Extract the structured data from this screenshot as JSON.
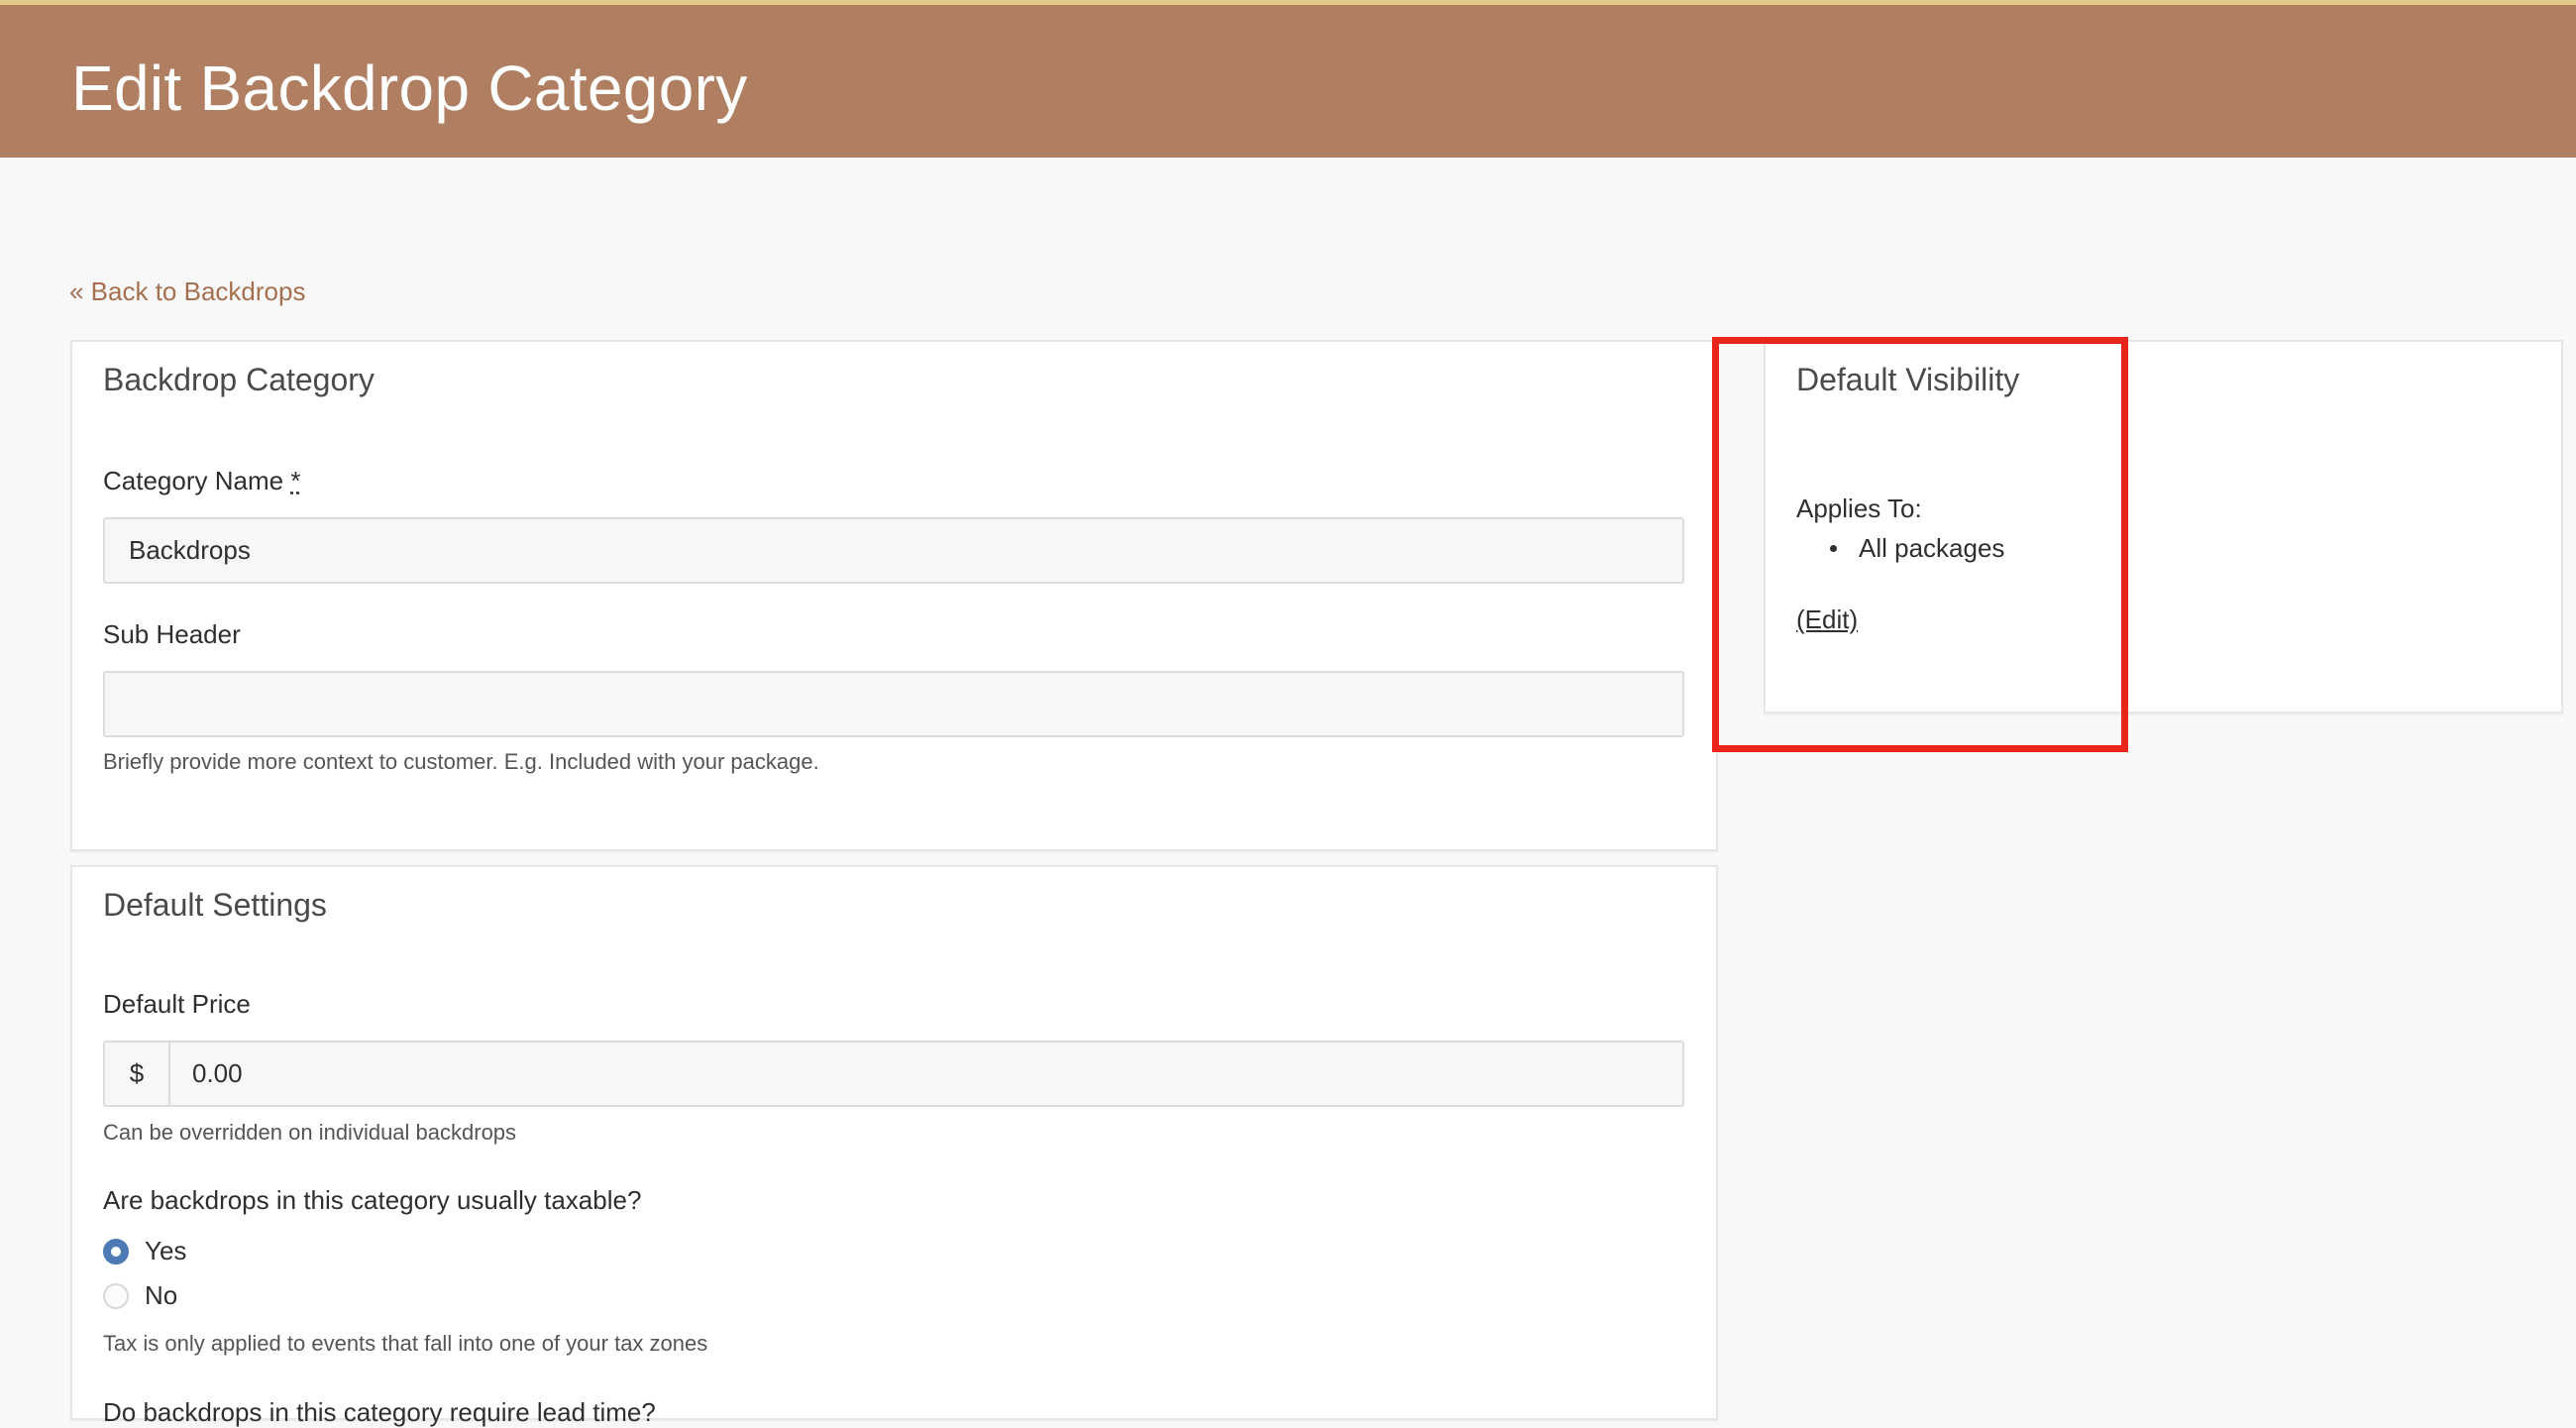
{
  "header": {
    "title": "Edit Backdrop Category"
  },
  "nav": {
    "back_link": "« Back to Backdrops"
  },
  "backdrop_category_card": {
    "title": "Backdrop Category",
    "category_name_label": "Category Name",
    "required_marker": "*",
    "category_name_value": "Backdrops",
    "sub_header_label": "Sub Header",
    "sub_header_value": "",
    "sub_header_help": "Briefly provide more context to customer. E.g. Included with your package."
  },
  "default_settings_card": {
    "title": "Default Settings",
    "default_price_label": "Default Price",
    "currency_symbol": "$",
    "default_price_value": "0.00",
    "default_price_help": "Can be overridden on individual backdrops",
    "taxable_question": "Are backdrops in this category usually taxable?",
    "taxable_options": [
      {
        "label": "Yes",
        "selected": true
      },
      {
        "label": "No",
        "selected": false
      }
    ],
    "taxable_help": "Tax is only applied to events that fall into one of your tax zones",
    "next_question_partial": "Do backdrops in this category require lead time?"
  },
  "visibility_card": {
    "title": "Default Visibility",
    "applies_to_label": "Applies To:",
    "applies_to_items": [
      "All packages"
    ],
    "edit_link": "(Edit)"
  },
  "colors": {
    "header_bg": "#b07f61",
    "link": "#a5704f",
    "radio_selected": "#4d79b5",
    "highlight_box": "#e8241b"
  }
}
